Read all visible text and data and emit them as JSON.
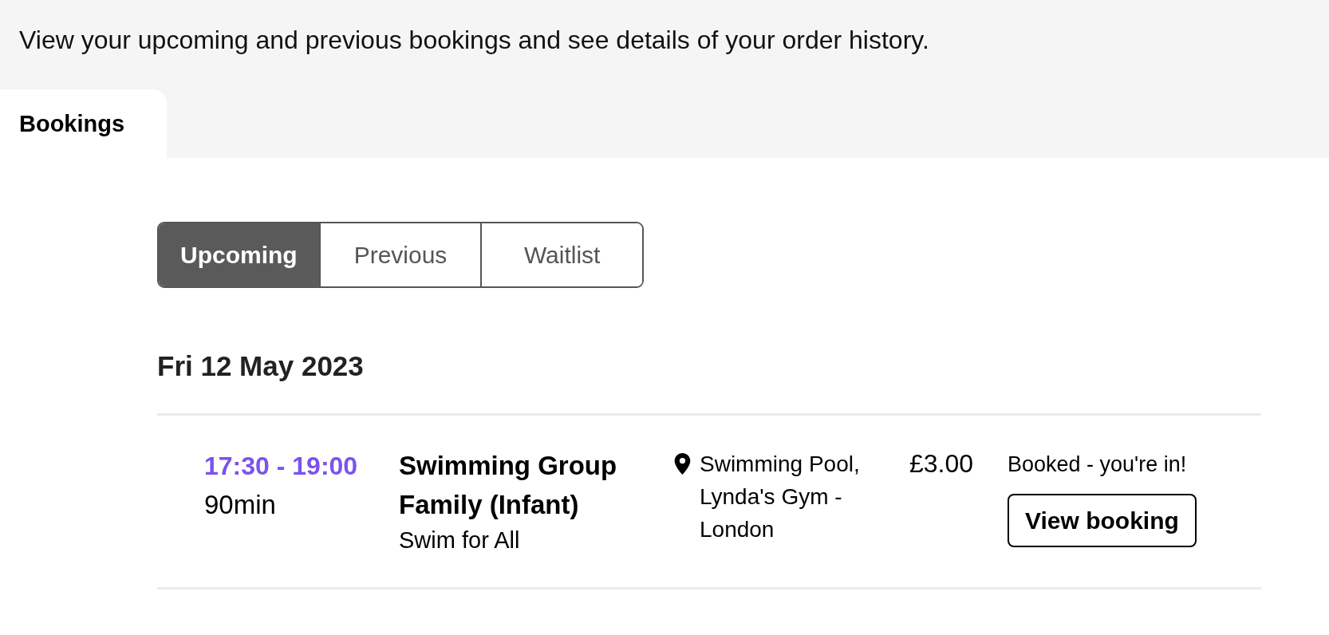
{
  "intro": "View your upcoming and previous bookings and see details of your order history.",
  "tabs": [
    {
      "label": "Bookings",
      "selected": true
    }
  ],
  "filter": [
    {
      "label": "Upcoming",
      "selected": true
    },
    {
      "label": "Previous",
      "selected": false
    },
    {
      "label": "Waitlist",
      "selected": false
    }
  ],
  "days": [
    {
      "date": "Fri 12 May 2023",
      "bookings": [
        {
          "time": "17:30 - 19:00",
          "duration": "90min",
          "title": "Swimming Group Family (Infant)",
          "subtitle": "Swim for All",
          "location": "Swimming Pool, Lynda's Gym - London",
          "price": "£3.00",
          "status": "Booked - you're in!",
          "action": "View booking"
        }
      ]
    }
  ]
}
